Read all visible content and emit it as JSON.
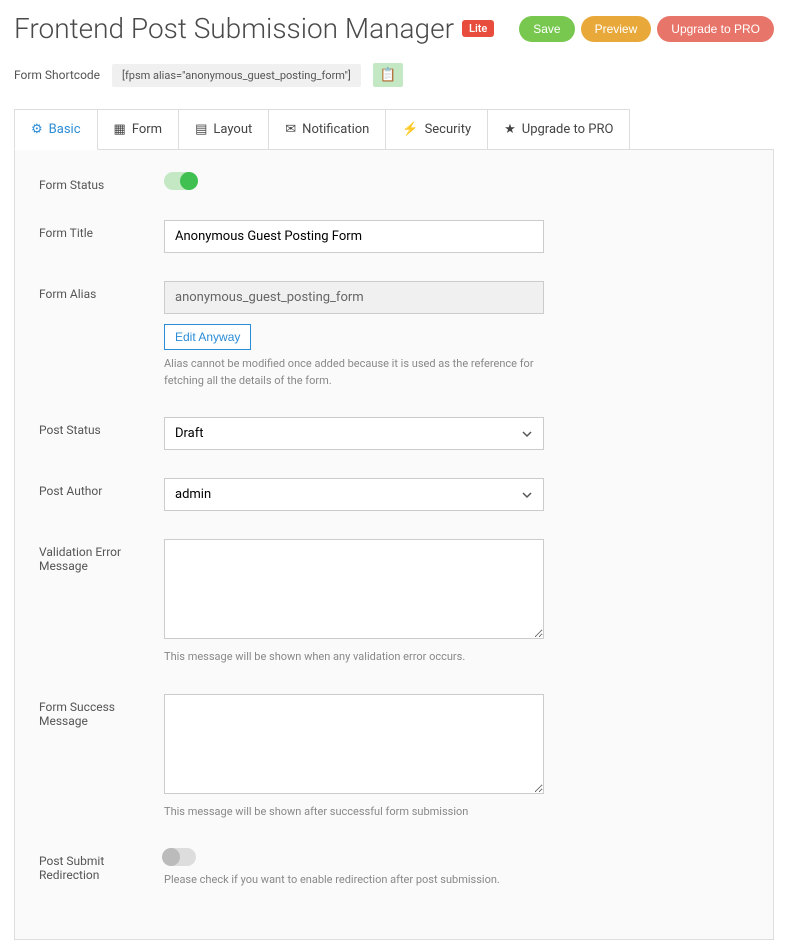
{
  "header": {
    "title": "Frontend Post Submission Manager",
    "lite_badge": "Lite",
    "buttons": {
      "save": "Save",
      "preview": "Preview",
      "upgrade": "Upgrade to PRO"
    }
  },
  "shortcode": {
    "label": "Form Shortcode",
    "value": "[fpsm alias=\"anonymous_guest_posting_form\"]"
  },
  "tabs": {
    "basic": "Basic",
    "form": "Form",
    "layout": "Layout",
    "notification": "Notification",
    "security": "Security",
    "upgrade": "Upgrade to PRO"
  },
  "fields": {
    "form_status": {
      "label": "Form Status"
    },
    "form_title": {
      "label": "Form Title",
      "value": "Anonymous Guest Posting Form"
    },
    "form_alias": {
      "label": "Form Alias",
      "value": "anonymous_guest_posting_form",
      "edit_button": "Edit Anyway",
      "help": "Alias cannot be modified once added because it is used as the reference for fetching all the details of the form."
    },
    "post_status": {
      "label": "Post Status",
      "value": "Draft"
    },
    "post_author": {
      "label": "Post Author",
      "value": "admin"
    },
    "validation_error": {
      "label": "Validation Error Message",
      "value": "",
      "help": "This message will be shown when any validation error occurs."
    },
    "form_success": {
      "label": "Form Success Message",
      "value": "",
      "help": "This message will be shown after successful form submission"
    },
    "post_submit_redirection": {
      "label": "Post Submit Redirection",
      "help": "Please check if you want to enable redirection after post submission."
    }
  }
}
